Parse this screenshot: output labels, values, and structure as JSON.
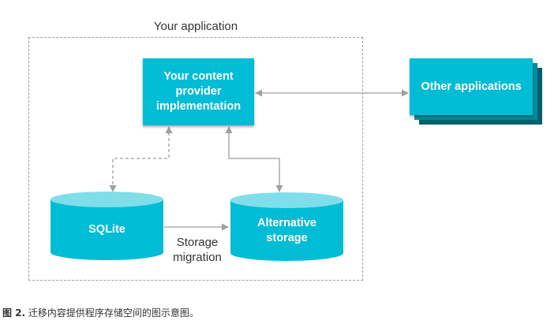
{
  "frame": {
    "label": "Your application"
  },
  "nodes": {
    "provider": "Your content\nprovider\nimplementation",
    "other_apps": "Other applications",
    "sqlite": "SQLite",
    "alt_storage": "Alternative\nstorage"
  },
  "edges": {
    "migration": "Storage\nmigration"
  },
  "caption": {
    "figure": "图 2.",
    "text": "迁移内容提供程序存储空间的图示意图。"
  },
  "colors": {
    "box": "#00bcd4",
    "box_shadow_1": "#008a9c",
    "box_shadow_2": "#00606b",
    "cylinder_top": "#80deea",
    "arrow": "#9e9e9e"
  }
}
